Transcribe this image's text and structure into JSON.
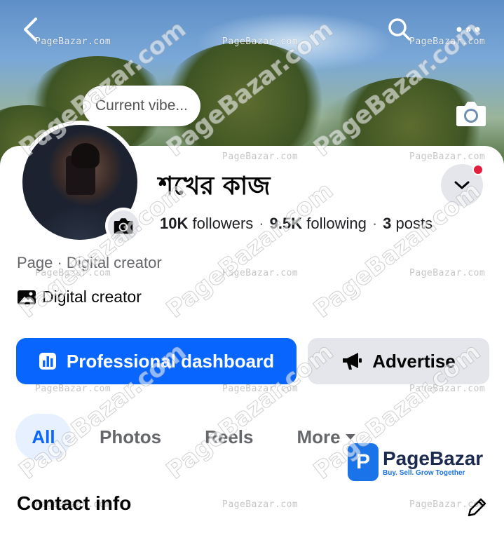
{
  "topbar": {
    "back_icon": "chevron-left-icon",
    "search_icon": "search-icon",
    "more_icon": "more-dots-icon"
  },
  "note": {
    "text": "Current vibe..."
  },
  "profile": {
    "name": "শখের কাজ",
    "followers_count": "10K",
    "followers_label": "followers",
    "following_count": "9.5K",
    "following_label": "following",
    "posts_count": "3",
    "posts_label": "posts",
    "sep": "·",
    "category_line": "Page · Digital creator",
    "creator_label": "Digital creator"
  },
  "buttons": {
    "dashboard_label": "Professional dashboard",
    "advertise_label": "Advertise"
  },
  "tabs": [
    {
      "label": "All",
      "active": true
    },
    {
      "label": "Photos",
      "active": false
    },
    {
      "label": "Reels",
      "active": false
    },
    {
      "label": "More",
      "active": false
    }
  ],
  "section": {
    "contact_info_title": "Contact info"
  },
  "watermark": {
    "small_text": "PageBazar.com",
    "big_text": "PageBazar.com",
    "brand_name": "PageBazar",
    "brand_tagline": "Buy. Sell. Grow Together"
  },
  "colors": {
    "primary": "#0866ff",
    "secondary_bg": "#e4e6eb",
    "notification_dot": "#e41e3f",
    "active_tab_bg": "#e7f0fe"
  }
}
